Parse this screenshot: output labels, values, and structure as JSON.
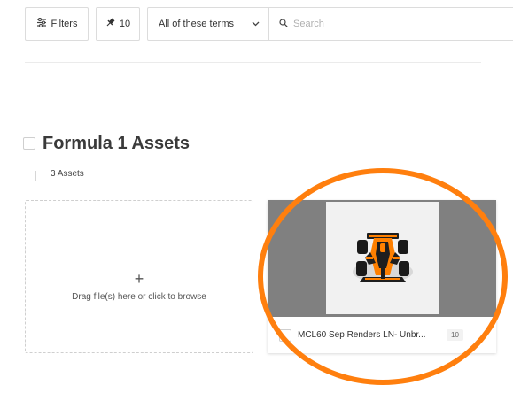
{
  "toolbar": {
    "filters_label": "Filters",
    "filters_icon": "sliders-icon",
    "pin_count": "10",
    "pin_icon": "pin-icon",
    "terms_select": "All of these terms",
    "search_placeholder": "Search"
  },
  "section": {
    "title": "Formula 1 Assets",
    "asset_count": "3 Assets"
  },
  "dropzone": {
    "plus": "+",
    "text": "Drag file(s) here or click to browse"
  },
  "assets": [
    {
      "name": "MCL60 Sep Renders LN- Unbr...",
      "badge": "10",
      "thumbnail_bg": "#808080",
      "car_colors": [
        "#ff8000",
        "#1e1e1e"
      ]
    }
  ],
  "colors": {
    "highlight_ring": "#ff7f0e",
    "border": "#dcdcdc"
  }
}
